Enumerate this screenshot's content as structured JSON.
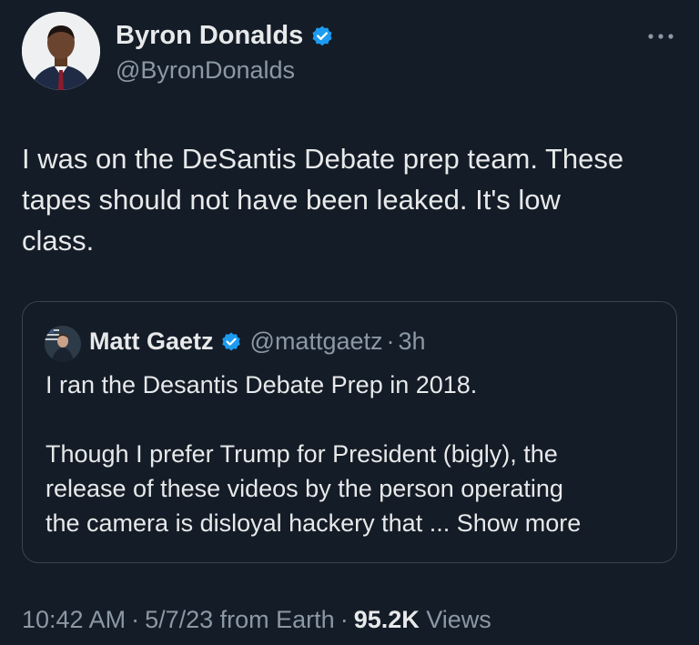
{
  "author": {
    "name": "Byron Donalds",
    "handle": "@ByronDonalds",
    "verified": true,
    "avatar_icon": "profile-photo"
  },
  "tweet": {
    "text_lines": [
      "I was on the DeSantis Debate prep team. These",
      "tapes should not have been leaked. It's low",
      "class."
    ]
  },
  "quote": {
    "name": "Matt Gaetz",
    "handle": "@mattgaetz",
    "dot": "·",
    "time": "3h",
    "verified": true,
    "line1": "I ran the Desantis Debate Prep in 2018.",
    "line2": "Though I prefer Trump for President (bigly), the",
    "line3": "release of these videos by the person operating",
    "line4_prefix": "the camera is disloyal hackery that ...",
    "show_more": "Show more"
  },
  "meta": {
    "time": "10:42 AM",
    "date": "5/7/23 from Earth",
    "sep": "·",
    "views_count": "95.2K",
    "views_label": "Views"
  },
  "colors": {
    "background": "#141c27",
    "text_primary": "#e7e9ea",
    "text_secondary": "#8b98a5",
    "verified_badge": "#1d9bf0",
    "card_border": "#38444d"
  },
  "icons": {
    "verified": "verified-badge-icon",
    "more": "more-horizontal-icon"
  }
}
